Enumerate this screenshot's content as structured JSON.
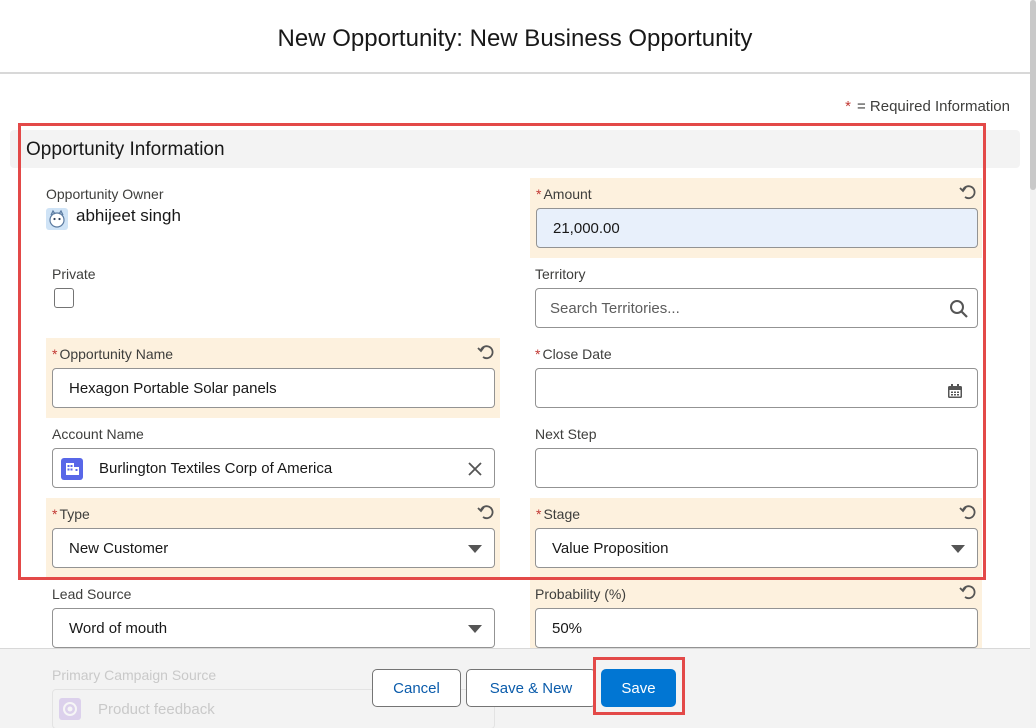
{
  "modal": {
    "title": "New Opportunity: New Business Opportunity",
    "required_star": "*",
    "required_text": "= Required Information"
  },
  "section": {
    "title": "Opportunity Information"
  },
  "fields": {
    "owner": {
      "label": "Opportunity Owner",
      "value": "abhijeet singh"
    },
    "amount": {
      "star": "*",
      "label": "Amount",
      "value": "21,000.00"
    },
    "private": {
      "label": "Private",
      "checked": false
    },
    "territory": {
      "label": "Territory",
      "placeholder": "Search Territories..."
    },
    "opp_name": {
      "star": "*",
      "label": "Opportunity Name",
      "value": "Hexagon Portable Solar panels"
    },
    "close_date": {
      "star": "*",
      "label": "Close Date",
      "value": ""
    },
    "account": {
      "label": "Account Name",
      "value": "Burlington Textiles Corp of America"
    },
    "next_step": {
      "label": "Next Step",
      "value": ""
    },
    "type": {
      "star": "*",
      "label": "Type",
      "value": "New Customer"
    },
    "stage": {
      "star": "*",
      "label": "Stage",
      "value": "Value Proposition"
    },
    "lead_source": {
      "label": "Lead Source",
      "value": "Word of mouth"
    },
    "probability": {
      "label": "Probability (%)",
      "value": "50%"
    },
    "campaign": {
      "label": "Primary Campaign Source",
      "value": "Product feedback"
    }
  },
  "footer": {
    "cancel_label": "Cancel",
    "save_new_label": "Save & New",
    "save_label": "Save"
  },
  "colors": {
    "brand": "#0176d3",
    "changed_field_bg": "#fdf1de",
    "required_star": "#c23934",
    "annotation_border": "#e34948"
  }
}
